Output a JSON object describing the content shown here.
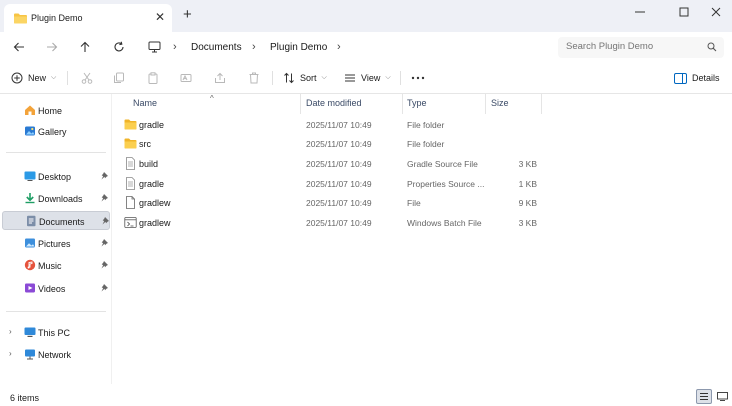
{
  "window": {
    "tab_title": "Plugin Demo",
    "accent": "#0067c0",
    "folder_color": "#f7c444"
  },
  "address": {
    "breadcrumbs": [
      "Documents",
      "Plugin Demo"
    ],
    "search_placeholder": "Search Plugin Demo"
  },
  "toolbar": {
    "new_label": "New",
    "sort_label": "Sort",
    "view_label": "View",
    "details_label": "Details"
  },
  "sidebar": {
    "top": [
      {
        "label": "Home",
        "icon": "home-icon"
      },
      {
        "label": "Gallery",
        "icon": "gallery-icon"
      }
    ],
    "quick": [
      {
        "label": "Desktop",
        "icon": "desktop-icon"
      },
      {
        "label": "Downloads",
        "icon": "downloads-icon"
      },
      {
        "label": "Documents",
        "icon": "documents-icon"
      },
      {
        "label": "Pictures",
        "icon": "pictures-icon"
      },
      {
        "label": "Music",
        "icon": "music-icon"
      },
      {
        "label": "Videos",
        "icon": "videos-icon"
      }
    ],
    "bottom": [
      {
        "label": "This PC",
        "icon": "pc-icon"
      },
      {
        "label": "Network",
        "icon": "network-icon"
      }
    ],
    "selected": "Documents"
  },
  "columns": {
    "name": "Name",
    "date": "Date modified",
    "type": "Type",
    "size": "Size"
  },
  "files": [
    {
      "name": "gradle",
      "date": "2025/11/07 10:49",
      "type": "File folder",
      "size": "",
      "icon": "folder-icon"
    },
    {
      "name": "src",
      "date": "2025/11/07 10:49",
      "type": "File folder",
      "size": "",
      "icon": "folder-icon"
    },
    {
      "name": "build",
      "date": "2025/11/07 10:49",
      "type": "Gradle Source File",
      "size": "3 KB",
      "icon": "document-icon"
    },
    {
      "name": "gradle",
      "date": "2025/11/07 10:49",
      "type": "Properties Source ...",
      "size": "1 KB",
      "icon": "document-icon"
    },
    {
      "name": "gradlew",
      "date": "2025/11/07 10:49",
      "type": "File",
      "size": "9 KB",
      "icon": "blank-file-icon"
    },
    {
      "name": "gradlew",
      "date": "2025/11/07 10:49",
      "type": "Windows Batch File",
      "size": "3 KB",
      "icon": "batch-file-icon"
    }
  ],
  "status": {
    "item_count": "6 items"
  }
}
